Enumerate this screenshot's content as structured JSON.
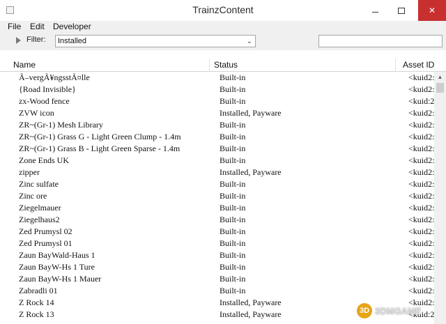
{
  "window": {
    "title": "TrainzContent"
  },
  "menu": {
    "items": [
      "File",
      "Edit",
      "Developer"
    ]
  },
  "filter": {
    "label": "Filter:",
    "selected": "Installed",
    "search_value": ""
  },
  "table": {
    "columns": [
      "Name",
      "Status",
      "Asset ID"
    ],
    "rows": [
      {
        "name": "Ã–vergÃ¥ngsstÃ¤lle",
        "status": "Built-in",
        "asset": "<kuid2:"
      },
      {
        "name": "{Road Invisible}",
        "status": "Built-in",
        "asset": "<kuid2:"
      },
      {
        "name": "zx-Wood fence",
        "status": "Built-in",
        "asset": "<kuid:2"
      },
      {
        "name": "ZVW icon",
        "status": "Installed, Payware",
        "asset": "<kuid2:"
      },
      {
        "name": "ZR~(Gr-1) Mesh Library",
        "status": "Built-in",
        "asset": "<kuid2:"
      },
      {
        "name": "ZR~(Gr-1) Grass G - Light Green Clump - 1.4m",
        "status": "Built-in",
        "asset": "<kuid2:"
      },
      {
        "name": "ZR~(Gr-1) Grass B - Light Green Sparse - 1.4m",
        "status": "Built-in",
        "asset": "<kuid2:"
      },
      {
        "name": "Zone Ends UK",
        "status": "Built-in",
        "asset": "<kuid2:"
      },
      {
        "name": "zipper",
        "status": "Installed, Payware",
        "asset": "<kuid2:"
      },
      {
        "name": "Zinc sulfate",
        "status": "Built-in",
        "asset": "<kuid2:"
      },
      {
        "name": "Zinc ore",
        "status": "Built-in",
        "asset": "<kuid2:"
      },
      {
        "name": "Ziegelmauer",
        "status": "Built-in",
        "asset": "<kuid2:"
      },
      {
        "name": "Ziegelhaus2",
        "status": "Built-in",
        "asset": "<kuid2:"
      },
      {
        "name": "Zed Prumysl 02",
        "status": "Built-in",
        "asset": "<kuid2:"
      },
      {
        "name": "Zed Prumysl 01",
        "status": "Built-in",
        "asset": "<kuid2:"
      },
      {
        "name": "Zaun BayWald-Haus 1",
        "status": "Built-in",
        "asset": "<kuid2:"
      },
      {
        "name": "Zaun BayW-Hs 1 Ture",
        "status": "Built-in",
        "asset": "<kuid2:"
      },
      {
        "name": "Zaun BayW-Hs 1 Mauer",
        "status": "Built-in",
        "asset": "<kuid2:"
      },
      {
        "name": "Zabradli 01",
        "status": "Built-in",
        "asset": "<kuid2:"
      },
      {
        "name": "Z Rock 14",
        "status": "Installed, Payware",
        "asset": "<kuid2:"
      },
      {
        "name": "Z Rock 13",
        "status": "Installed, Payware",
        "asset": "<kuid:2"
      }
    ]
  },
  "watermark": {
    "icon_text": "3D",
    "text": "3DMGAME"
  }
}
